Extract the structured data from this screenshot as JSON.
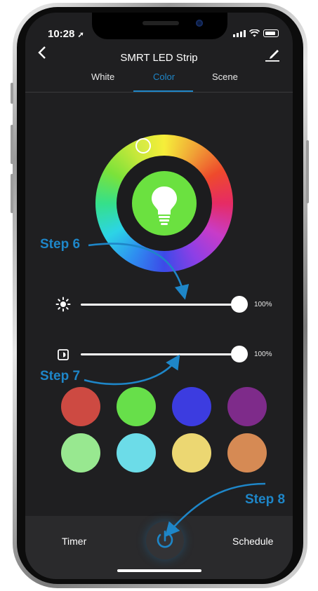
{
  "status": {
    "time": "10:28"
  },
  "nav": {
    "title": "SMRT LED Strip"
  },
  "tabs": [
    {
      "label": "White"
    },
    {
      "label": "Color"
    },
    {
      "label": "Scene"
    }
  ],
  "sliders": {
    "brightness": {
      "value_label": "100%",
      "level": 1.0
    },
    "saturation": {
      "value_label": "100%",
      "level": 1.0
    }
  },
  "color_presets": [
    "#cd4a42",
    "#67df4a",
    "#3c3ce0",
    "#7e2b8a",
    "#98e890",
    "#6cdce8",
    "#ecd772",
    "#d68a54"
  ],
  "bottom": {
    "timer_label": "Timer",
    "schedule_label": "Schedule"
  },
  "annotations": {
    "step6": "Step 6",
    "step7": "Step 7",
    "step8": "Step 8"
  },
  "colors": {
    "accent": "#1e86c8",
    "bulb_active": "#6be140",
    "background": "#1f1f21"
  }
}
